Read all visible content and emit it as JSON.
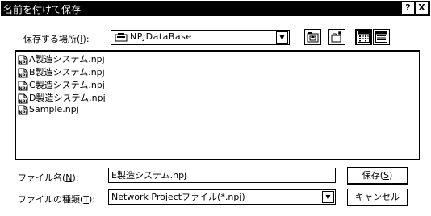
{
  "window": {
    "title": "名前を付けて保存",
    "help_label": "?",
    "close_label": "X"
  },
  "save_in": {
    "label": "保存する場所(I):",
    "value": "NPJDataBase"
  },
  "toolbar": {
    "icons": [
      "up-folder-icon",
      "new-folder-icon",
      "list-view-icon",
      "details-view-icon"
    ]
  },
  "files": [
    {
      "name": "A製造システム.npj",
      "icon": "npj-file-icon"
    },
    {
      "name": "B製造システム.npj",
      "icon": "npj-file-icon"
    },
    {
      "name": "C製造システム.npj",
      "icon": "npj-file-icon"
    },
    {
      "name": "D製造システム.npj",
      "icon": "npj-file-icon"
    },
    {
      "name": "Sample.npj",
      "icon": "npj-file-icon"
    }
  ],
  "filename": {
    "label": "ファイル名(N):",
    "value": "E製造システム.npj"
  },
  "filetype": {
    "label": "ファイルの種類(T):",
    "value": "Network Projectファイル(*.npj)"
  },
  "buttons": {
    "save": "保存(S)",
    "cancel": "キャンセル"
  }
}
